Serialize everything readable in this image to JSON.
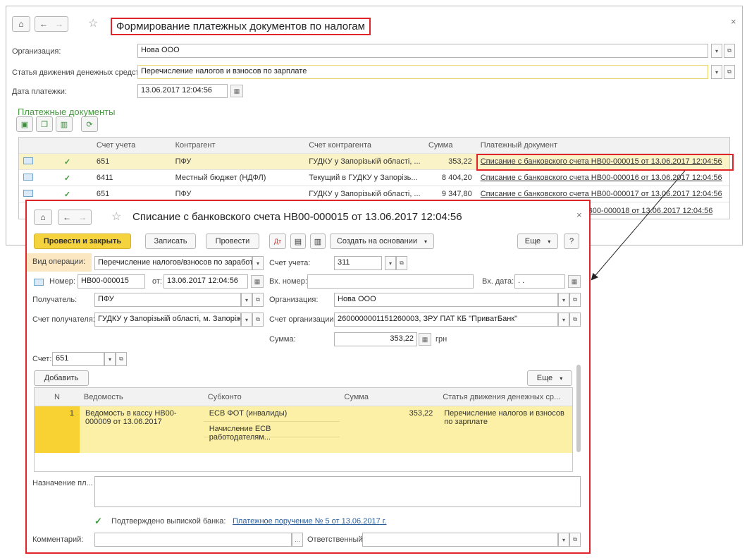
{
  "main_window": {
    "title": "Формирование платежных документов по налогам",
    "close": "×",
    "fields": {
      "organization_label": "Организация:",
      "organization_value": "Нова ООО",
      "cashflow_label": "Статья движения денежных средств:",
      "cashflow_value": "Перечисление налогов и взносов по зарплате",
      "date_label": "Дата платежки:",
      "date_value": "13.06.2017 12:04:56"
    },
    "section_title": "Платежные документы",
    "table": {
      "headers": [
        "",
        "",
        "Счет учета",
        "Контрагент",
        "Счет контрагента",
        "Сумма",
        "Платежный документ"
      ],
      "rows": [
        {
          "account": "651",
          "counterparty": "ПФУ",
          "counterparty_account": "ГУДКУ у Запорізькій області, ...",
          "amount": "353,22",
          "doc": "Списание с банковского счета НВ00-000015 от 13.06.2017 12:04:56"
        },
        {
          "account": "6411",
          "counterparty": "Местный бюджет (НДФЛ)",
          "counterparty_account": "Текущий в ГУДКУ у Запорізь...",
          "amount": "8 404,20",
          "doc": "Списание с банковского счета НВ00-000016 от 13.06.2017 12:04:56"
        },
        {
          "account": "651",
          "counterparty": "ПФУ",
          "counterparty_account": "ГУДКУ у Запорізькій області, ...",
          "amount": "9 347,80",
          "doc": "Списание с банковского счета НВ00-000017 от 13.06.2017 12:04:56"
        },
        {
          "account": "",
          "counterparty": "",
          "counterparty_account": "",
          "amount": "",
          "doc": "НВ00-000018 от 13.06.2017 12:04:56"
        }
      ]
    }
  },
  "doc_window": {
    "title": "Списание с банковского счета НВ00-000015 от 13.06.2017 12:04:56",
    "close": "×",
    "toolbar": {
      "post_close": "Провести и закрыть",
      "save": "Записать",
      "post": "Провести",
      "create_based": "Создать на основании",
      "more": "Еще",
      "help": "?"
    },
    "fields": {
      "op_type_label": "Вид операции:",
      "op_type_value": "Перечисление налогов/взносов по заработной",
      "account_label": "Счет учета:",
      "account_value": "311",
      "number_label": "Номер:",
      "number_value": "НВ00-000015",
      "from_label": "от:",
      "from_value": "13.06.2017 12:04:56",
      "in_number_label": "Вх. номер:",
      "in_number_value": "",
      "in_date_label": "Вх. дата:",
      "in_date_value": " .  .",
      "recipient_label": "Получатель:",
      "recipient_value": "ПФУ",
      "org_label": "Организация:",
      "org_value": "Нова ООО",
      "recipient_account_label": "Счет получателя:",
      "recipient_account_value": "ГУДКУ у Запорізькій області, м. Запоріжжя",
      "org_account_label": "Счет организации:",
      "org_account_value": "2600000001151260003, ЗРУ ПАТ КБ \"ПриватБанк\"",
      "sum_label": "Сумма:",
      "sum_value": "353,22",
      "currency": "грн",
      "acct_label": "Счет:",
      "acct_value": "651"
    },
    "add_button": "Добавить",
    "more2": "Еще",
    "grid": {
      "headers": [
        "N",
        "Ведомость",
        "Субконто",
        "Сумма",
        "Статья движения денежных ср..."
      ],
      "row": {
        "n": "1",
        "statement": "Ведомость в кассу НВ00-000009 от 13.06.2017",
        "subconto1": "ЕСВ ФОТ (инвалиды)",
        "subconto2": "Начисление ЕСВ работодателям...",
        "amount": "353,22",
        "cashflow": "Перечисление налогов и взносов по зарплате"
      }
    },
    "purpose_label": "Назначение пл...",
    "confirmed_label": "Подтверждено выпиской банка:",
    "confirmed_link": "Платежное поручение № 5 от 13.06.2017 г.",
    "comment_label": "Комментарий:",
    "responsible_label": "Ответственный:"
  }
}
